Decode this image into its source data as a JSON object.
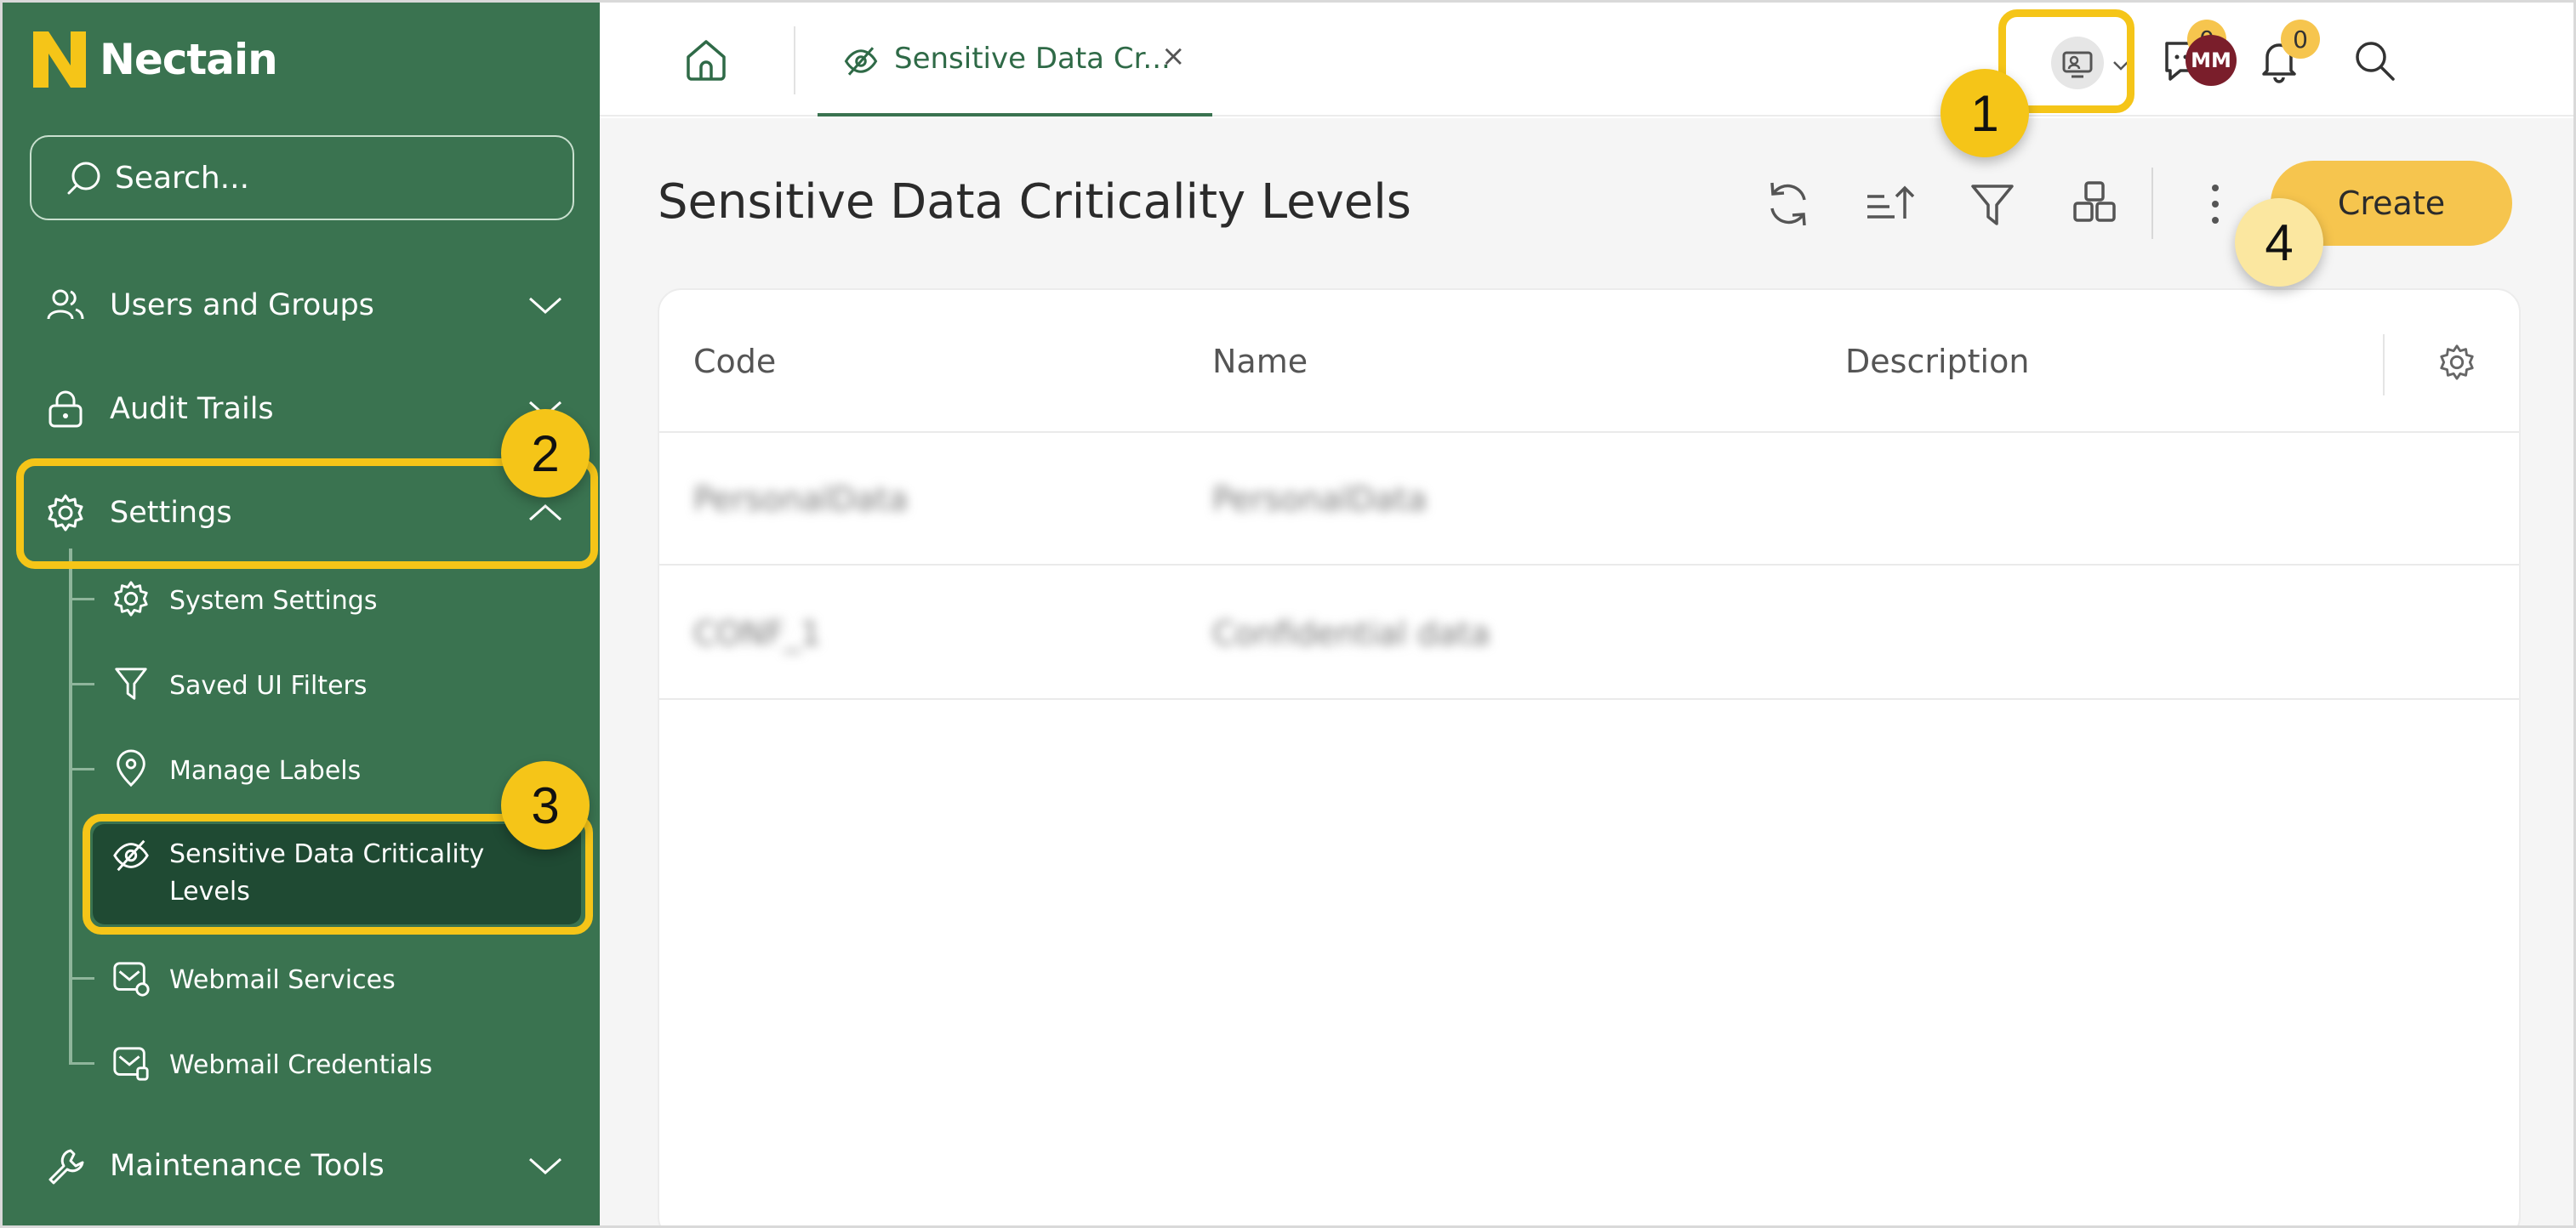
{
  "brand": {
    "name": "Nectain"
  },
  "sidebar": {
    "search_placeholder": "Search...",
    "items": [
      {
        "label": "Users and Groups"
      },
      {
        "label": "Audit Trails"
      },
      {
        "label": "Settings"
      },
      {
        "label": "Maintenance Tools"
      }
    ],
    "settings_children": [
      {
        "label": "System Settings"
      },
      {
        "label": "Saved UI Filters"
      },
      {
        "label": "Manage Labels"
      },
      {
        "label": "Sensitive Data Criticality Levels",
        "line1": "Sensitive Data Criticality",
        "line2": "Levels"
      },
      {
        "label": "Webmail Services"
      },
      {
        "label": "Webmail Credentials"
      }
    ]
  },
  "topbar": {
    "tab_label": "Sensitive Data Cr...",
    "tab_close": "×",
    "chat_count": "0",
    "notification_count": "0",
    "avatar_initials": "MM"
  },
  "main": {
    "title": "Sensitive Data Criticality Levels",
    "create_label": "Create",
    "columns": [
      "Code",
      "Name",
      "Description"
    ],
    "rows": [
      {
        "code": "PersonalData",
        "name": "PersonalData",
        "description": ""
      },
      {
        "code": "CONF_1",
        "name": "Confidential data",
        "description": ""
      }
    ]
  },
  "annotations": [
    "1",
    "2",
    "3",
    "4"
  ],
  "colors": {
    "sidebar": "#3a7350",
    "active": "#1f4a33",
    "accent": "#f6c54e",
    "highlight": "#f5c518"
  }
}
